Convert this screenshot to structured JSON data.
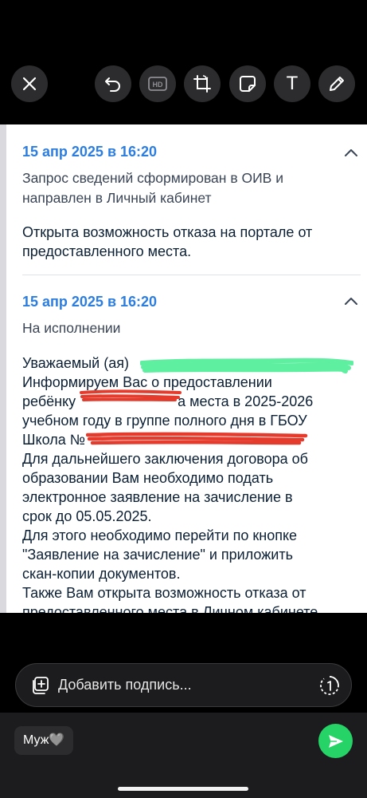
{
  "toolbar": {
    "items": [
      {
        "name": "close",
        "icon": "close-icon"
      },
      {
        "name": "undo",
        "icon": "undo-icon"
      },
      {
        "name": "hd",
        "icon": "hd-icon",
        "label": "HD"
      },
      {
        "name": "crop",
        "icon": "crop-rotate-icon"
      },
      {
        "name": "sticker",
        "icon": "sticker-icon"
      },
      {
        "name": "text",
        "icon": "text-icon",
        "label": "T"
      },
      {
        "name": "draw",
        "icon": "pencil-icon"
      }
    ]
  },
  "content": {
    "entry1": {
      "date": "15 апр 2025 в 16:20",
      "status_lines": [
        "Запрос сведений сформирован в ОИВ и",
        "направлен в Личный кабинет"
      ],
      "body_lines": [
        "Открыта возможность отказа на портале от",
        "предоставленного места."
      ]
    },
    "entry2": {
      "date": "15 апр 2025 в 16:20",
      "status": "На исполнении",
      "body_lines": [
        "Уважаемый (ая)",
        "Информируем Вас о предоставлении",
        "ребёнку",
        "а места в 2025-2026",
        "учебном году в группе полного дня в ГБОУ",
        "Школа №",
        "Для дальнейшего заключения договора об",
        "образовании Вам необходимо подать",
        "электронное заявление на зачисление в",
        "срок до 05.05.2025.",
        "Для этого необходимо перейти по кнопке",
        "\"Заявление на зачисление\" и приложить",
        "скан-копии документов.",
        "Также Вам открыта возможность отказа от",
        "предоставленного места в Личном кабинете."
      ]
    }
  },
  "caption": {
    "placeholder": "Добавить подпись...",
    "add_icon": "add-media-icon",
    "view_once_icon": "view-once-icon"
  },
  "footer": {
    "recipient": "Муж🩶",
    "send_icon": "send-icon"
  },
  "colors": {
    "accent_date": "#2c7de0",
    "send": "#25d366",
    "scribble_green": "#5ef0a0",
    "scribble_red": "#e43b2c"
  }
}
